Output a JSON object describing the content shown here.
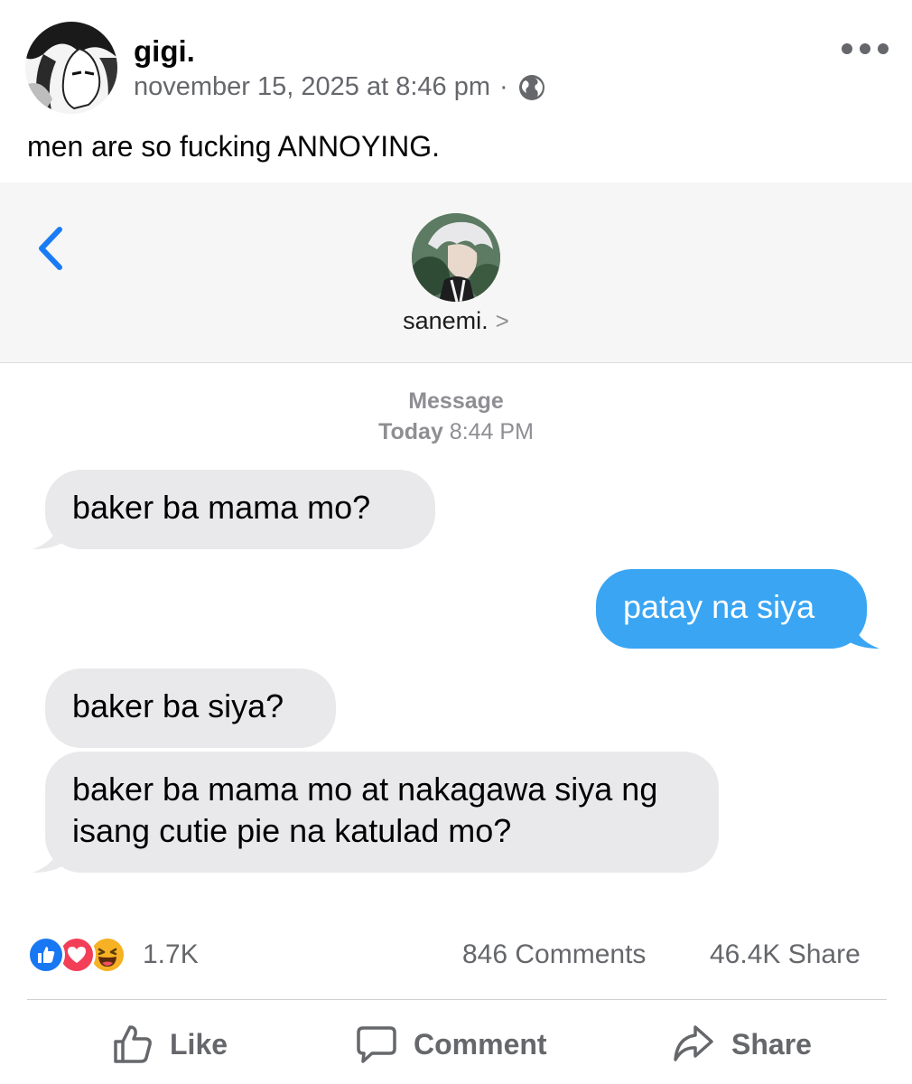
{
  "post": {
    "author": "gigi.",
    "timestamp": "november 15, 2025 at 8:46 pm",
    "separator": "·",
    "audience_icon": "globe-icon",
    "more_icon": "more-options-icon",
    "caption": "men are so fucking ANNOYING."
  },
  "screenshot": {
    "back_icon": "chevron-left-icon",
    "contact_name": "sanemi.",
    "contact_chevron": ">",
    "service": "Message",
    "date_day": "Today",
    "date_time": "8:44 PM",
    "messages": [
      {
        "direction": "incoming",
        "text": "baker ba mama mo?"
      },
      {
        "direction": "outgoing",
        "text": "patay na siya"
      },
      {
        "direction": "incoming",
        "text": "baker ba siya?"
      },
      {
        "direction": "incoming",
        "text": "baker ba mama mo at nakagawa siya ng isang cutie pie na katulad mo?"
      }
    ],
    "colors": {
      "incoming_bubble": "#e9e9eb",
      "outgoing_bubble": "#3aa5f3",
      "ios_blue": "#1a7cf5"
    }
  },
  "stats": {
    "reactions": [
      "like-icon",
      "love-icon",
      "haha-icon"
    ],
    "reaction_count": "1.7K",
    "comments": "846 Comments",
    "shares": "46.4K Share"
  },
  "actions": {
    "like": "Like",
    "comment": "Comment",
    "share": "Share"
  },
  "theme": {
    "facebook_blue": "#1877f2",
    "secondary_text": "#65676b"
  }
}
